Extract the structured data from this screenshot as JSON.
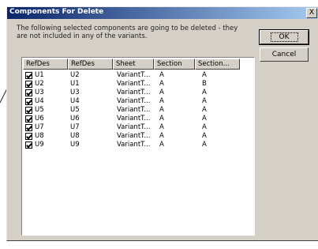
{
  "window": {
    "title": "Components For Delete",
    "close_glyph": "X"
  },
  "message": "The following selected components are going to be deleted - they are not included in any of the variants.",
  "buttons": {
    "ok": "OK",
    "cancel": "Cancel"
  },
  "columns": [
    "RefDes",
    "RefDes",
    "Sheet",
    "Section",
    "Section..."
  ],
  "rows": [
    {
      "checked": true,
      "cells": [
        "U1",
        "U2",
        "VariantT...",
        "A",
        "A"
      ]
    },
    {
      "checked": true,
      "cells": [
        "U2",
        "U1",
        "VariantT...",
        "A",
        "B"
      ]
    },
    {
      "checked": true,
      "cells": [
        "U3",
        "U3",
        "VariantT...",
        "A",
        "A"
      ]
    },
    {
      "checked": true,
      "cells": [
        "U4",
        "U4",
        "VariantT...",
        "A",
        "A"
      ]
    },
    {
      "checked": true,
      "cells": [
        "U5",
        "U5",
        "VariantT...",
        "A",
        "A"
      ]
    },
    {
      "checked": true,
      "cells": [
        "U6",
        "U6",
        "VariantT...",
        "A",
        "A"
      ]
    },
    {
      "checked": true,
      "cells": [
        "U7",
        "U7",
        "VariantT...",
        "A",
        "A"
      ]
    },
    {
      "checked": true,
      "cells": [
        "U8",
        "U8",
        "VariantT...",
        "A",
        "A"
      ]
    },
    {
      "checked": true,
      "cells": [
        "U9",
        "U9",
        "VariantT...",
        "A",
        "A"
      ]
    }
  ]
}
